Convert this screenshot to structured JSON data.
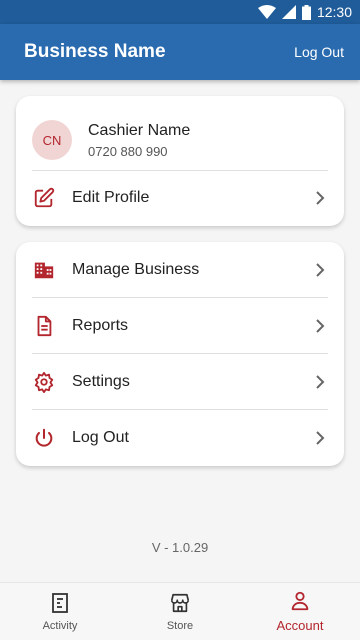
{
  "status_bar": {
    "time": "12:30"
  },
  "app_bar": {
    "title": "Business Name",
    "logout_label": "Log Out"
  },
  "profile": {
    "initials": "CN",
    "name": "Cashier Name",
    "phone": "0720 880 990",
    "edit_label": "Edit Profile"
  },
  "menu": {
    "items": [
      {
        "label": "Manage Business",
        "icon": "building-icon"
      },
      {
        "label": "Reports",
        "icon": "document-icon"
      },
      {
        "label": "Settings",
        "icon": "gear-icon"
      },
      {
        "label": "Log Out",
        "icon": "power-icon"
      }
    ]
  },
  "version": "V - 1.0.29",
  "bottom_nav": {
    "items": [
      {
        "label": "Activity",
        "icon": "receipt-icon"
      },
      {
        "label": "Store",
        "icon": "store-icon"
      },
      {
        "label": "Account",
        "icon": "person-icon",
        "active": true
      }
    ]
  },
  "colors": {
    "primary": "#2a6bb0",
    "status": "#1f5c99",
    "accent": "#b3262e"
  }
}
